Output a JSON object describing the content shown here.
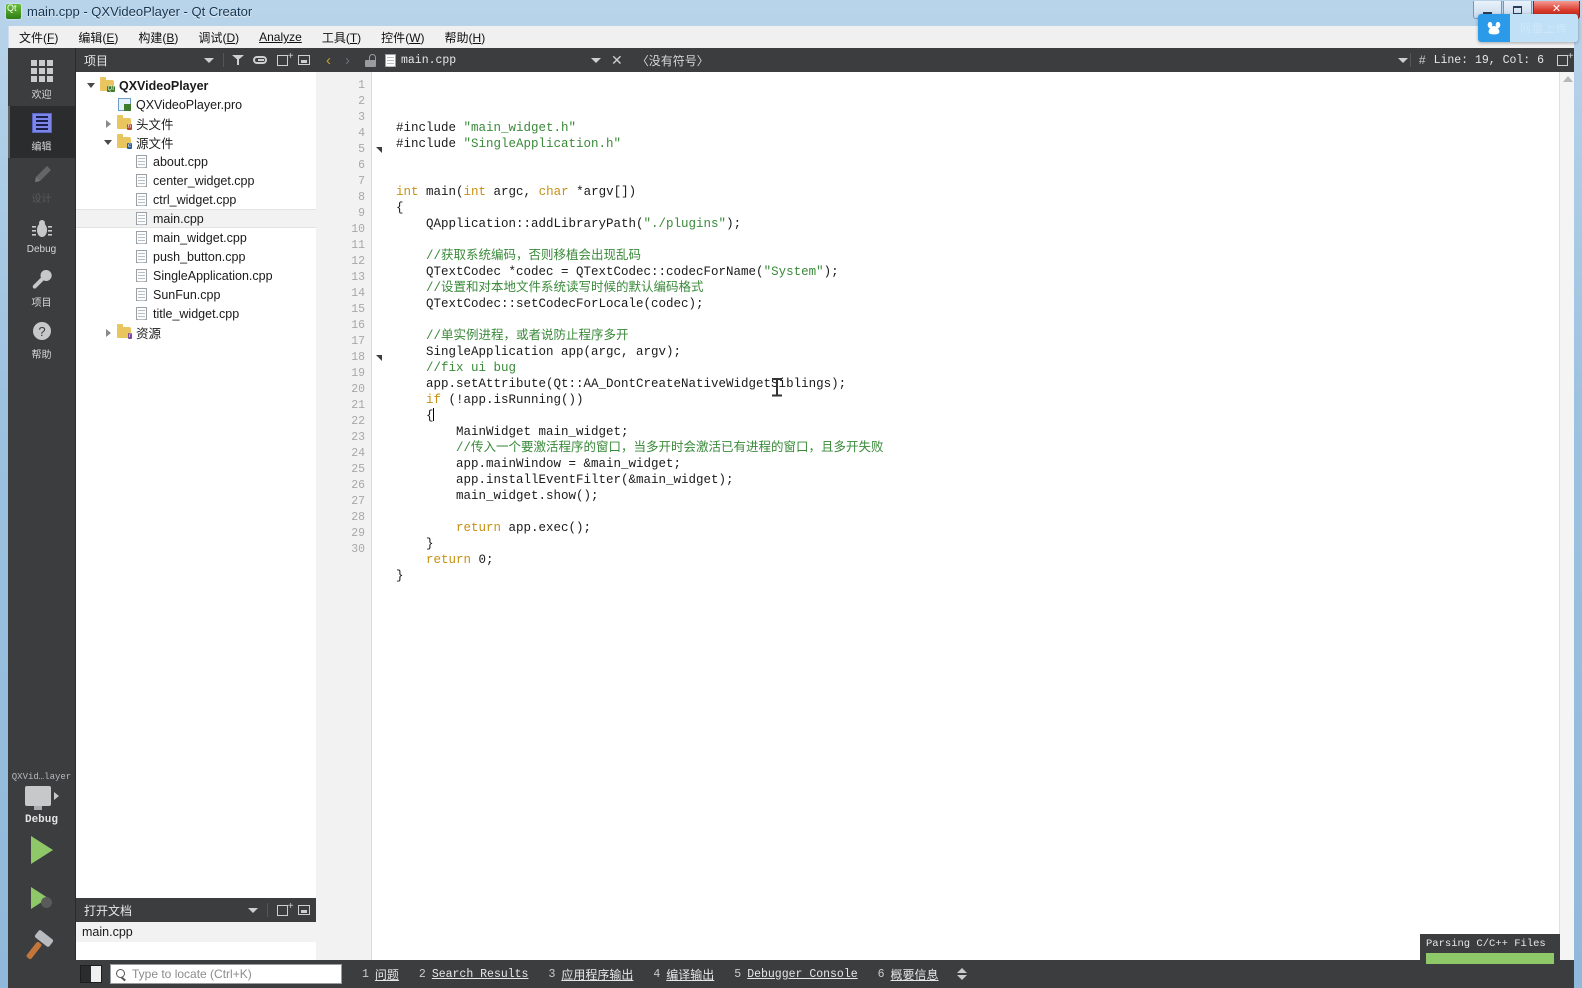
{
  "window": {
    "title": "main.cpp - QXVideoPlayer - Qt Creator",
    "app_icon": "qt-logo-icon",
    "minimize_label": "",
    "maximize_label": "",
    "close_label": "✕"
  },
  "float_widget": {
    "icon": "baidu-netdisk-icon",
    "label": "网盘上传"
  },
  "menubar": {
    "items": [
      {
        "label": "文件",
        "accel": "F"
      },
      {
        "label": "编辑",
        "accel": "E"
      },
      {
        "label": "构建",
        "accel": "B"
      },
      {
        "label": "调试",
        "accel": "D"
      },
      {
        "label": "Analyze",
        "accel": "A"
      },
      {
        "label": "工具",
        "accel": "T"
      },
      {
        "label": "控件",
        "accel": "W"
      },
      {
        "label": "帮助",
        "accel": "H"
      }
    ]
  },
  "modebar": {
    "items": [
      {
        "label": "欢迎",
        "icon": "grid-icon",
        "state": "normal"
      },
      {
        "label": "编辑",
        "icon": "edit-lines-icon",
        "state": "active"
      },
      {
        "label": "设计",
        "icon": "pencil-icon",
        "state": "disabled"
      },
      {
        "label": "Debug",
        "icon": "bug-icon",
        "state": "normal"
      },
      {
        "label": "项目",
        "icon": "wrench-icon",
        "state": "normal"
      },
      {
        "label": "帮助",
        "icon": "question-circle-icon",
        "state": "normal"
      }
    ],
    "kit": {
      "name": "QXVid…layer",
      "build_config": "Debug",
      "monitor_icon": "desktop-target-icon",
      "run_icon": "run-play-icon",
      "debug_icon": "debug-play-bug-icon",
      "build_icon": "hammer-build-icon"
    }
  },
  "project_dock": {
    "title": "项目",
    "tools": [
      {
        "icon": "chevron-down-icon"
      },
      {
        "icon": "filter-icon"
      },
      {
        "icon": "link-icon"
      },
      {
        "icon": "split-icon"
      },
      {
        "icon": "collapse-icon"
      }
    ],
    "tree": [
      {
        "label": "QXVideoPlayer",
        "depth": 0,
        "twist": "open",
        "icon": "project-folder-icon",
        "bold": true,
        "selected": false
      },
      {
        "label": "QXVideoPlayer.pro",
        "depth": 1,
        "twist": "none",
        "icon": "pro-file-icon",
        "bold": false,
        "selected": false
      },
      {
        "label": "头文件",
        "depth": 1,
        "twist": "closed",
        "icon": "folder-h-icon",
        "bold": false,
        "selected": false
      },
      {
        "label": "源文件",
        "depth": 1,
        "twist": "open",
        "icon": "folder-cpp-icon",
        "bold": false,
        "selected": false
      },
      {
        "label": "about.cpp",
        "depth": 2,
        "twist": "none",
        "icon": "file-icon",
        "bold": false,
        "selected": false
      },
      {
        "label": "center_widget.cpp",
        "depth": 2,
        "twist": "none",
        "icon": "file-icon",
        "bold": false,
        "selected": false
      },
      {
        "label": "ctrl_widget.cpp",
        "depth": 2,
        "twist": "none",
        "icon": "file-icon",
        "bold": false,
        "selected": false
      },
      {
        "label": "main.cpp",
        "depth": 2,
        "twist": "none",
        "icon": "file-icon",
        "bold": false,
        "selected": true
      },
      {
        "label": "main_widget.cpp",
        "depth": 2,
        "twist": "none",
        "icon": "file-icon",
        "bold": false,
        "selected": false
      },
      {
        "label": "push_button.cpp",
        "depth": 2,
        "twist": "none",
        "icon": "file-icon",
        "bold": false,
        "selected": false
      },
      {
        "label": "SingleApplication.cpp",
        "depth": 2,
        "twist": "none",
        "icon": "file-icon",
        "bold": false,
        "selected": false
      },
      {
        "label": "SunFun.cpp",
        "depth": 2,
        "twist": "none",
        "icon": "file-icon",
        "bold": false,
        "selected": false
      },
      {
        "label": "title_widget.cpp",
        "depth": 2,
        "twist": "none",
        "icon": "file-icon",
        "bold": false,
        "selected": false
      },
      {
        "label": "资源",
        "depth": 1,
        "twist": "closed",
        "icon": "folder-res-icon",
        "bold": false,
        "selected": false
      }
    ]
  },
  "opendocs_dock": {
    "title": "打开文档",
    "tools": [
      {
        "icon": "chevron-down-icon"
      },
      {
        "icon": "split-icon"
      },
      {
        "icon": "collapse-icon"
      }
    ],
    "documents": [
      {
        "label": "main.cpp",
        "selected": true
      }
    ]
  },
  "editor_toolbar": {
    "back_icon": "nav-back-icon",
    "forward_icon": "nav-forward-icon",
    "lock_icon": "unlocked-icon",
    "file_icon": "file-icon",
    "filename": "main.cpp",
    "dropdown_icon": "chevron-down-icon",
    "close_icon": "close-icon",
    "symbol_selector": "〈没有符号〉",
    "symbol_dropdown_icon": "chevron-down-icon",
    "line_col_icon": "#",
    "line_col": "Line: 19, Col: 6",
    "split_icon": "split-icon"
  },
  "editor": {
    "first_line": 1,
    "total_lines": 30,
    "fold_markers": [
      5,
      18
    ],
    "cursor_line": 19,
    "cursor_col": 6,
    "lines": [
      {
        "n": 1,
        "tokens": [
          {
            "t": "#include ",
            "c": "p"
          },
          {
            "t": "\"main_widget.h\"",
            "c": "s"
          }
        ]
      },
      {
        "n": 2,
        "tokens": [
          {
            "t": "#include ",
            "c": "p"
          },
          {
            "t": "\"SingleApplication.h\"",
            "c": "s"
          }
        ]
      },
      {
        "n": 3,
        "tokens": []
      },
      {
        "n": 4,
        "tokens": []
      },
      {
        "n": 5,
        "tokens": [
          {
            "t": "int",
            "c": "k"
          },
          {
            "t": " main(",
            "c": "p"
          },
          {
            "t": "int",
            "c": "k"
          },
          {
            "t": " argc, ",
            "c": "p"
          },
          {
            "t": "char",
            "c": "k"
          },
          {
            "t": " *argv[])",
            "c": "p"
          }
        ]
      },
      {
        "n": 6,
        "tokens": [
          {
            "t": "{",
            "c": "p"
          }
        ]
      },
      {
        "n": 7,
        "tokens": [
          {
            "t": "    QApplication::addLibraryPath(",
            "c": "p"
          },
          {
            "t": "\"./plugins\"",
            "c": "s"
          },
          {
            "t": ");",
            "c": "p"
          }
        ]
      },
      {
        "n": 8,
        "tokens": []
      },
      {
        "n": 9,
        "tokens": [
          {
            "t": "    //获取系统编码，否则移植会出现乱码",
            "c": "cm"
          }
        ]
      },
      {
        "n": 10,
        "tokens": [
          {
            "t": "    QTextCodec *codec = QTextCodec::codecForName(",
            "c": "p"
          },
          {
            "t": "\"System\"",
            "c": "s"
          },
          {
            "t": ");",
            "c": "p"
          }
        ]
      },
      {
        "n": 11,
        "tokens": [
          {
            "t": "    //设置和对本地文件系统读写时候的默认编码格式",
            "c": "cm"
          }
        ]
      },
      {
        "n": 12,
        "tokens": [
          {
            "t": "    QTextCodec::setCodecForLocale(codec);",
            "c": "p"
          }
        ]
      },
      {
        "n": 13,
        "tokens": []
      },
      {
        "n": 14,
        "tokens": [
          {
            "t": "    //单实例进程，或者说防止程序多开",
            "c": "cm"
          }
        ]
      },
      {
        "n": 15,
        "tokens": [
          {
            "t": "    SingleApplication app(argc, argv);",
            "c": "p"
          }
        ]
      },
      {
        "n": 16,
        "tokens": [
          {
            "t": "    //fix ui bug",
            "c": "cm"
          }
        ]
      },
      {
        "n": 17,
        "tokens": [
          {
            "t": "    app.setAttribute(Qt::AA_DontCreateNativeWidgetSiblings);",
            "c": "p"
          }
        ]
      },
      {
        "n": 18,
        "tokens": [
          {
            "t": "    ",
            "c": "p"
          },
          {
            "t": "if",
            "c": "k"
          },
          {
            "t": " (!app.isRunning())",
            "c": "p"
          }
        ]
      },
      {
        "n": 19,
        "tokens": [
          {
            "t": "    {",
            "c": "p"
          }
        ],
        "cursor": true
      },
      {
        "n": 20,
        "tokens": [
          {
            "t": "        MainWidget main_widget;",
            "c": "p"
          }
        ]
      },
      {
        "n": 21,
        "tokens": [
          {
            "t": "        //传入一个要激活程序的窗口，当多开时会激活已有进程的窗口，且多开失败",
            "c": "cm"
          }
        ]
      },
      {
        "n": 22,
        "tokens": [
          {
            "t": "        app.mainWindow = &main_widget;",
            "c": "p"
          }
        ]
      },
      {
        "n": 23,
        "tokens": [
          {
            "t": "        app.installEventFilter(&main_widget);",
            "c": "p"
          }
        ]
      },
      {
        "n": 24,
        "tokens": [
          {
            "t": "        main_widget.show();",
            "c": "p"
          }
        ]
      },
      {
        "n": 25,
        "tokens": []
      },
      {
        "n": 26,
        "tokens": [
          {
            "t": "        ",
            "c": "p"
          },
          {
            "t": "return",
            "c": "k"
          },
          {
            "t": " app.exec();",
            "c": "p"
          }
        ]
      },
      {
        "n": 27,
        "tokens": [
          {
            "t": "    }",
            "c": "p"
          }
        ]
      },
      {
        "n": 28,
        "tokens": [
          {
            "t": "    ",
            "c": "p"
          },
          {
            "t": "return",
            "c": "k"
          },
          {
            "t": " 0;",
            "c": "p"
          }
        ]
      },
      {
        "n": 29,
        "tokens": [
          {
            "t": "}",
            "c": "p"
          }
        ]
      },
      {
        "n": 30,
        "tokens": []
      }
    ]
  },
  "parsing_popup": {
    "label": "Parsing C/C++ Files",
    "progress": 100
  },
  "statusbar": {
    "sidebar_toggle_icon": "toggle-sidebar-icon",
    "locator": {
      "icon": "search-icon",
      "value": "",
      "placeholder": "Type to locate (Ctrl+K)"
    },
    "panes": [
      {
        "num": "1",
        "label": "问题",
        "mono": false
      },
      {
        "num": "2",
        "label": "Search Results",
        "mono": true
      },
      {
        "num": "3",
        "label": "应用程序输出",
        "mono": false
      },
      {
        "num": "4",
        "label": "编译输出",
        "mono": false
      },
      {
        "num": "5",
        "label": "Debugger Console",
        "mono": true
      },
      {
        "num": "6",
        "label": "概要信息",
        "mono": false
      }
    ],
    "updown_icon": "updown-arrows-icon"
  },
  "colors": {
    "chrome_dark": "#3b3d3f",
    "accent_green": "#8fc868",
    "keyword": "#c89011",
    "string": "#3a8a3a",
    "comment": "#3a8a3a",
    "selection": "#f2f2f2"
  }
}
